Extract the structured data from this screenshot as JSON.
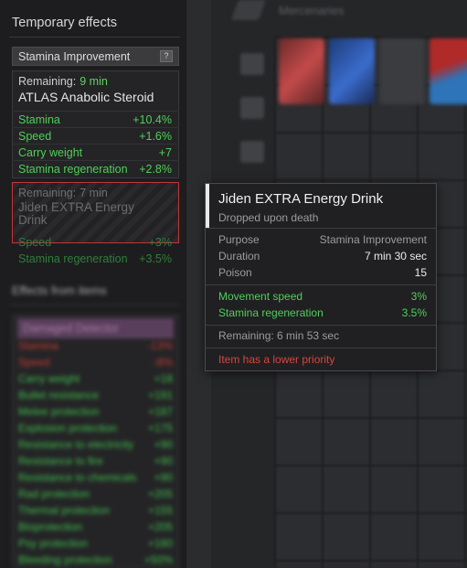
{
  "background": {
    "tab_label": "Mercenaries"
  },
  "panel": {
    "title": "Temporary effects",
    "category": {
      "label": "Stamina Improvement",
      "help_label": "?"
    },
    "active_effect": {
      "remaining_label": "Remaining:",
      "remaining_value": "9 min",
      "name": "ATLAS Anabolic Steroid",
      "stats": [
        {
          "name": "Stamina",
          "value": "+10.4%"
        },
        {
          "name": "Speed",
          "value": "+1.6%"
        },
        {
          "name": "Carry weight",
          "value": "+7"
        },
        {
          "name": "Stamina regeneration",
          "value": "+2.8%"
        }
      ]
    },
    "lower_effect": {
      "remaining_label": "Remaining:",
      "remaining_value": "7 min",
      "name": "Jiden EXTRA Energy Drink",
      "stats": [
        {
          "name": "Speed",
          "value": "+3%"
        },
        {
          "name": "Stamina regeneration",
          "value": "+3.5%"
        }
      ]
    },
    "items_section": {
      "title": "Effects from items",
      "header": "Damaged Detector",
      "rows": [
        {
          "name": "Stamina",
          "value": "-13%",
          "kind": "bad"
        },
        {
          "name": "Speed",
          "value": "-8%",
          "kind": "bad"
        },
        {
          "name": "Carry weight",
          "value": "+18",
          "kind": "good"
        },
        {
          "name": "Bullet resistance",
          "value": "+191",
          "kind": "good"
        },
        {
          "name": "Melee protection",
          "value": "+187",
          "kind": "good"
        },
        {
          "name": "Explosion protection",
          "value": "+175",
          "kind": "good"
        },
        {
          "name": "Resistance to electricity",
          "value": "+90",
          "kind": "good"
        },
        {
          "name": "Resistance to fire",
          "value": "+90",
          "kind": "good"
        },
        {
          "name": "Resistance to chemicals",
          "value": "+90",
          "kind": "good"
        },
        {
          "name": "Rad protection",
          "value": "+205",
          "kind": "good"
        },
        {
          "name": "Thermal protection",
          "value": "+155",
          "kind": "good"
        },
        {
          "name": "Bioprotection",
          "value": "+205",
          "kind": "good"
        },
        {
          "name": "Psy protection",
          "value": "+180",
          "kind": "good"
        },
        {
          "name": "Bleeding protection",
          "value": "+50%",
          "kind": "good"
        }
      ]
    }
  },
  "tooltip": {
    "name": "Jiden EXTRA Energy Drink",
    "subtitle": "Dropped upon death",
    "info": [
      {
        "key": "Purpose",
        "value": "Stamina Improvement"
      },
      {
        "key": "Duration",
        "value": "7 min 30 sec"
      },
      {
        "key": "Poison",
        "value": "15"
      }
    ],
    "effects": [
      {
        "key": "Movement speed",
        "value": "3%"
      },
      {
        "key": "Stamina regeneration",
        "value": "3.5%"
      }
    ],
    "remaining": "Remaining: 6 min 53 sec",
    "warning": "Item has a lower priority"
  },
  "colors": {
    "positive": "#4fcf58",
    "negative": "#d9443e",
    "lower_priority_border": "#c0363a",
    "category_purple": "#a77ca8"
  }
}
